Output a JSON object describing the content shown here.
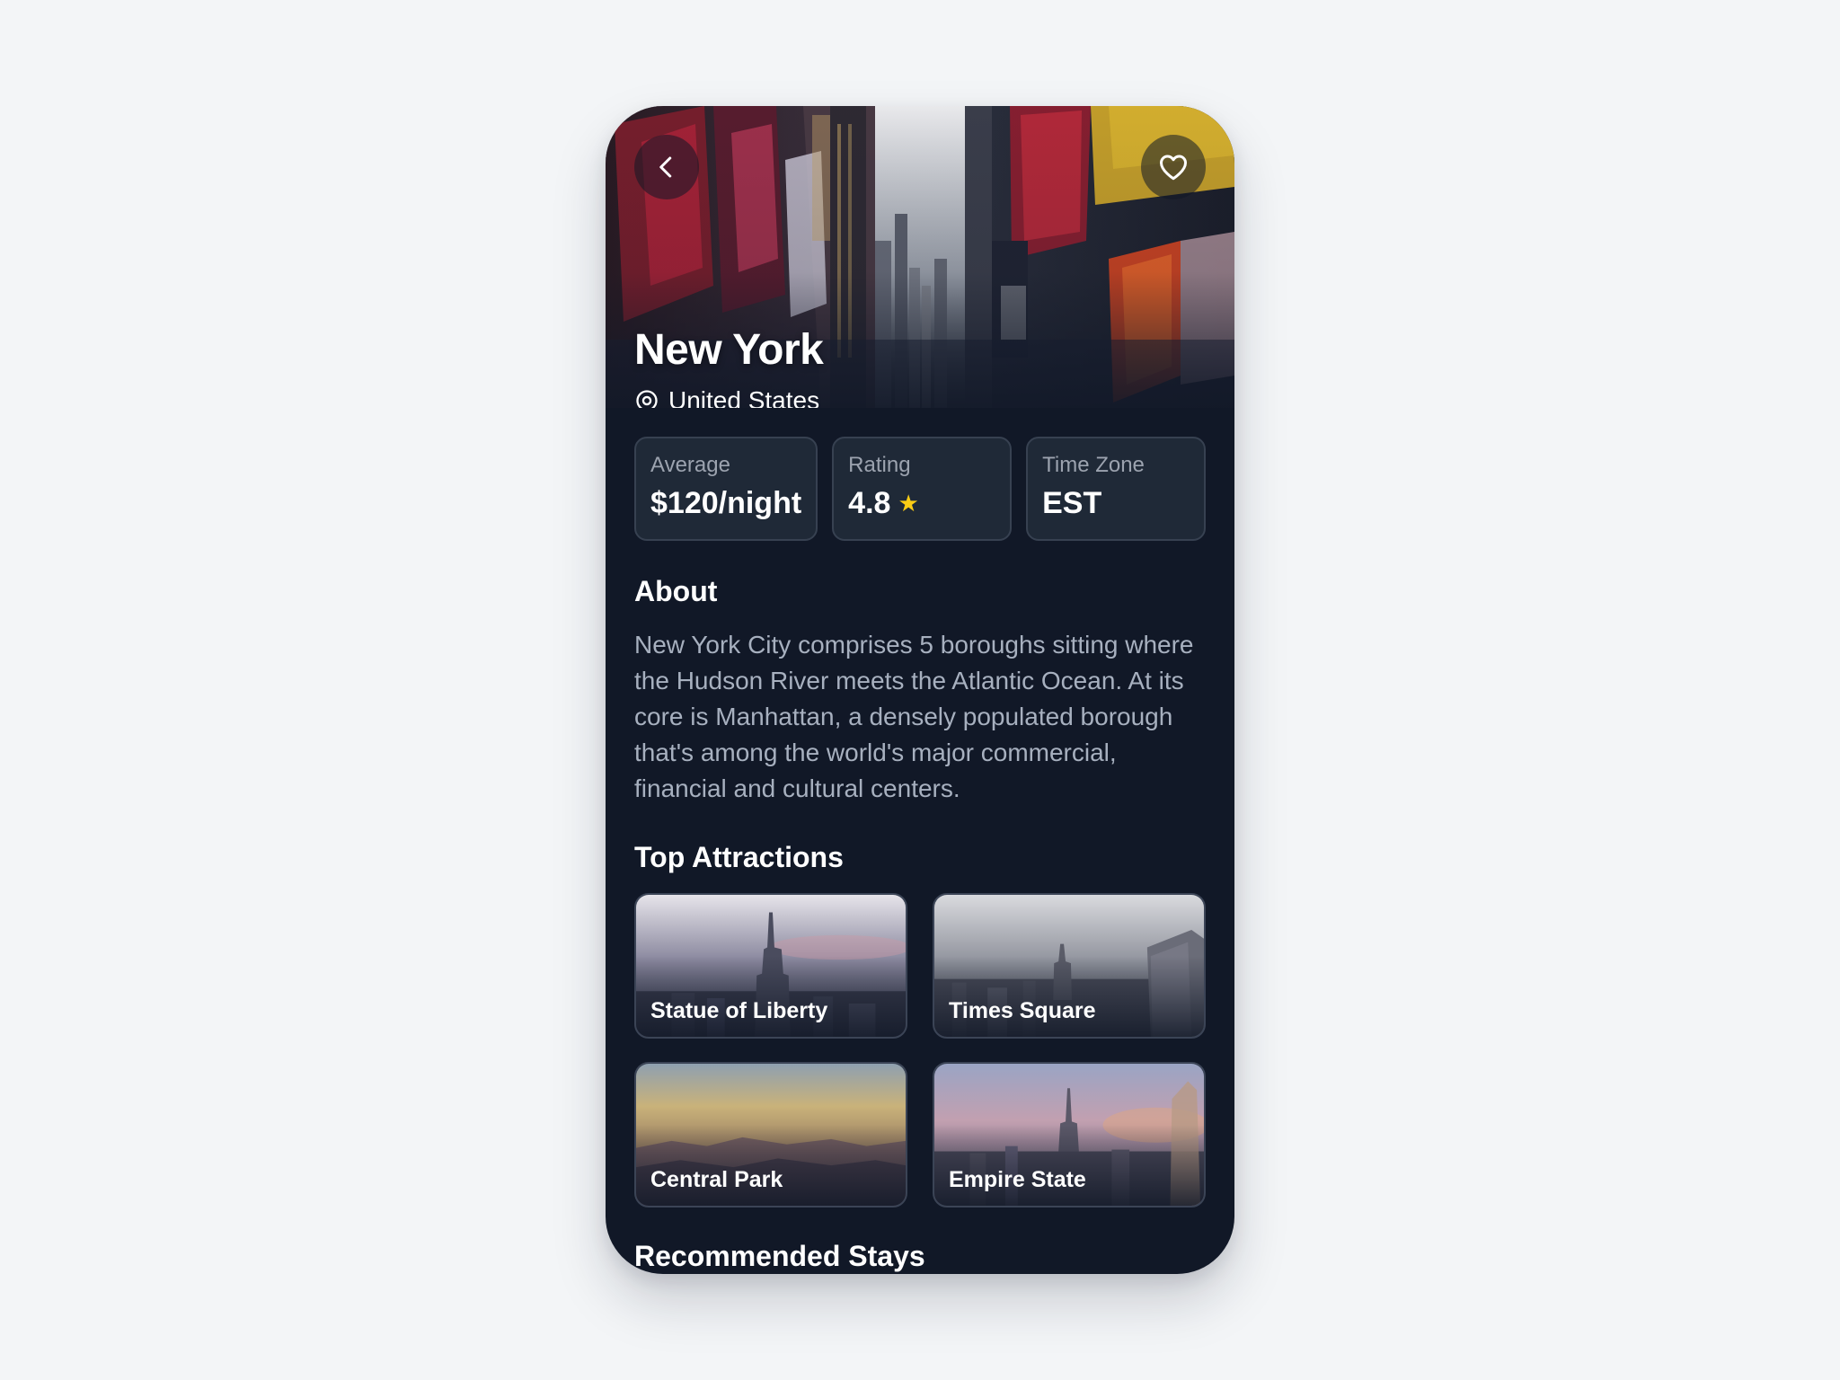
{
  "destination": {
    "city": "New York",
    "country": "United States"
  },
  "stats": [
    {
      "label": "Average",
      "value": "$120/night"
    },
    {
      "label": "Rating",
      "value": "4.8",
      "icon": "star-icon"
    },
    {
      "label": "Time Zone",
      "value": "EST"
    }
  ],
  "about": {
    "title": "About",
    "text": "New York City comprises 5 boroughs sitting where the Hudson River meets the Atlantic Ocean. At its core is Manhattan, a densely populated borough that's among the world's major commercial, financial and cultural centers."
  },
  "attractions": {
    "title": "Top Attractions",
    "items": [
      {
        "name": "Statue of Liberty"
      },
      {
        "name": "Times Square"
      },
      {
        "name": "Central Park"
      },
      {
        "name": "Empire State"
      }
    ]
  },
  "recommended": {
    "title": "Recommended Stays"
  },
  "icons": {
    "back": "chevron-left-icon",
    "favorite": "heart-icon",
    "location": "location-pin-icon"
  },
  "colors": {
    "background": "#111827",
    "card": "#1f2937",
    "border": "#374151",
    "star": "#facc15",
    "muted_text": "#9ca3af"
  }
}
